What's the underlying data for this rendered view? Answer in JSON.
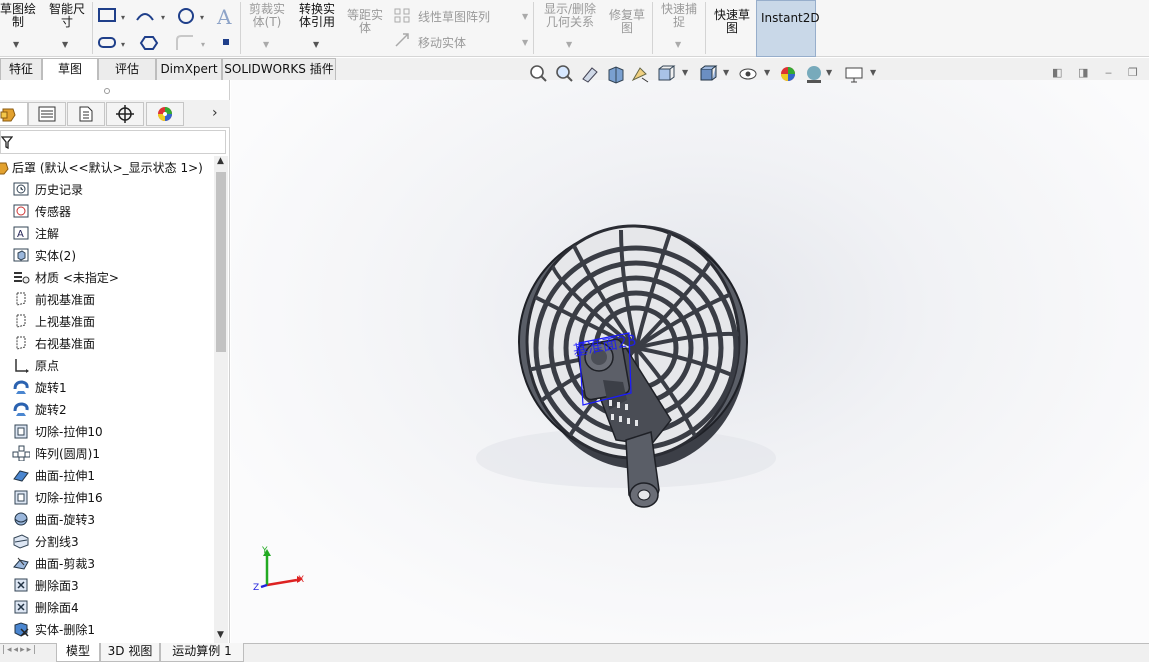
{
  "ribbon": {
    "sketch_draw_label": "草图绘\n制",
    "smart_dim_label": "智能尺\n寸",
    "trim_label": "剪裁实\n体(T)",
    "convert_label": "转换实\n体引用",
    "offset_label": "等距实\n体",
    "linear_pattern_label": "线性草图阵列",
    "move_entities_label": "移动实体",
    "display_relations_label": "显示/删除\n几何关系",
    "repair_label": "修复草\n图",
    "quick_snaps_label": "快速捕\n捉",
    "rapid_sketch_label": "快速草\n图",
    "instant2d_label": "Instant2D"
  },
  "command_tabs": [
    {
      "label": "特征",
      "active": false
    },
    {
      "label": "草图",
      "active": true
    },
    {
      "label": "评估",
      "active": false
    },
    {
      "label": "DimXpert",
      "active": false
    },
    {
      "label": "SOLIDWORKS 插件",
      "active": false
    }
  ],
  "feature_tree": {
    "root": "后罩 (默认<<默认>_显示状态 1>)",
    "items": [
      {
        "label": "历史记录",
        "icon": "history-icon"
      },
      {
        "label": "传感器",
        "icon": "sensor-icon"
      },
      {
        "label": "注解",
        "icon": "annotation-icon"
      },
      {
        "label": "实体(2)",
        "icon": "solid-bodies-icon"
      },
      {
        "label": "材质 <未指定>",
        "icon": "material-icon"
      },
      {
        "label": "前视基准面",
        "icon": "plane-icon"
      },
      {
        "label": "上视基准面",
        "icon": "plane-icon"
      },
      {
        "label": "右视基准面",
        "icon": "plane-icon"
      },
      {
        "label": "原点",
        "icon": "origin-icon"
      },
      {
        "label": "旋转1",
        "icon": "revolve-icon"
      },
      {
        "label": "旋转2",
        "icon": "revolve-icon"
      },
      {
        "label": "切除-拉伸10",
        "icon": "cut-extrude-icon"
      },
      {
        "label": "阵列(圆周)1",
        "icon": "circular-pattern-icon"
      },
      {
        "label": "曲面-拉伸1",
        "icon": "surface-extrude-icon"
      },
      {
        "label": "切除-拉伸16",
        "icon": "cut-extrude-icon"
      },
      {
        "label": "曲面-旋转3",
        "icon": "surface-revolve-icon"
      },
      {
        "label": "分割线3",
        "icon": "split-line-icon"
      },
      {
        "label": "曲面-剪裁3",
        "icon": "surface-trim-icon"
      },
      {
        "label": "删除面3",
        "icon": "delete-face-icon"
      },
      {
        "label": "删除面4",
        "icon": "delete-face-icon"
      },
      {
        "label": "实体-删除1",
        "icon": "delete-body-icon"
      }
    ]
  },
  "viewport": {
    "plane_label": "基准面23",
    "triad": {
      "x": "X",
      "y": "Y",
      "z": "Z"
    },
    "accent_color": "#1a1aff"
  },
  "bottom_tabs": [
    {
      "label": "模型",
      "active": true
    },
    {
      "label": "3D 视图",
      "active": false
    },
    {
      "label": "运动算例 1",
      "active": false
    }
  ]
}
